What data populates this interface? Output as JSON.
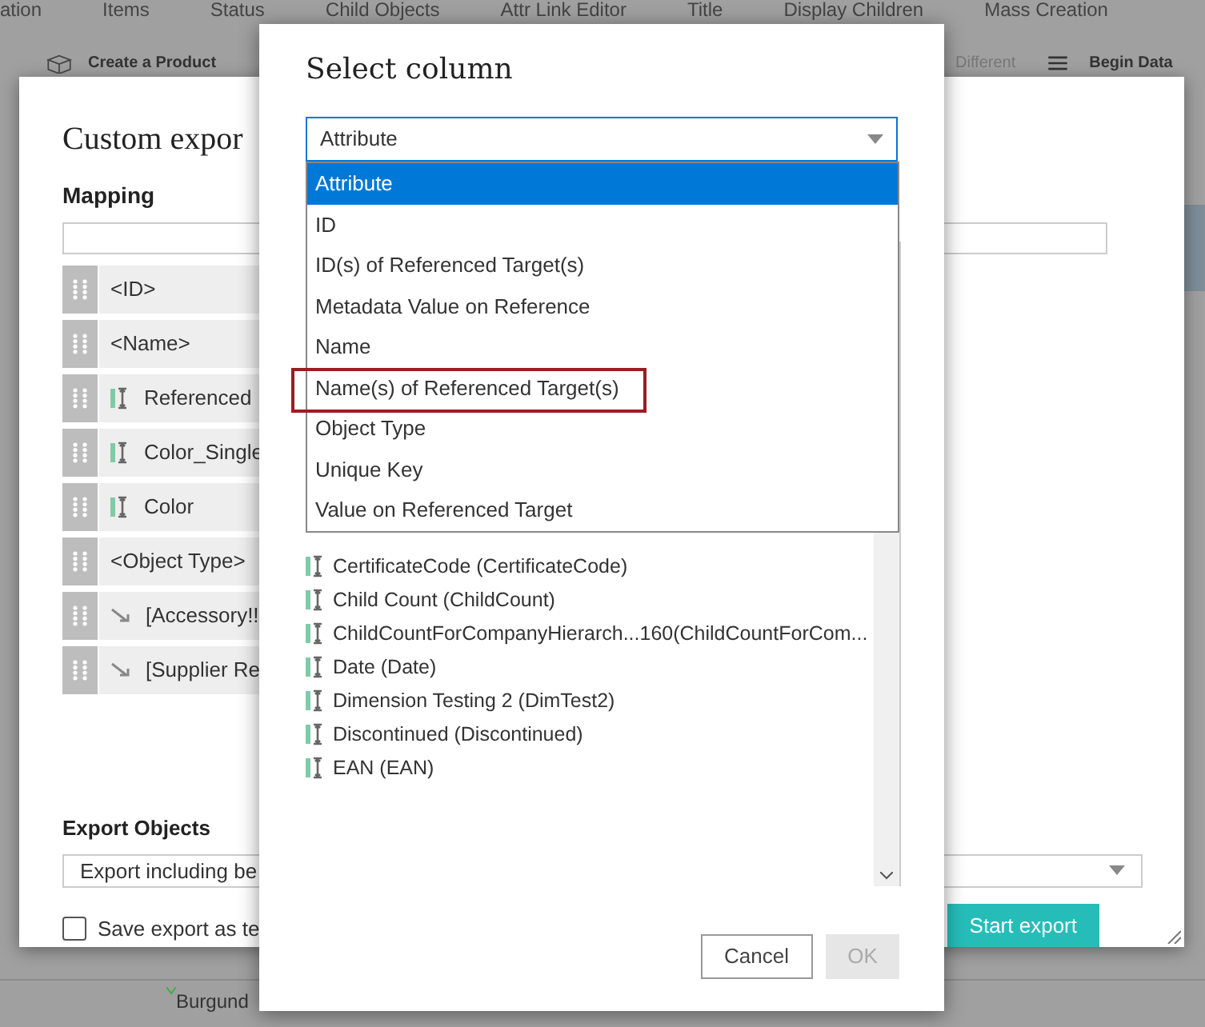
{
  "app_tabs": [
    "ation",
    "Items",
    "Status",
    "Child Objects",
    "Attr Link Editor",
    "Title",
    "Display Children",
    "Mass Creation"
  ],
  "toolbar": {
    "create": "Create a Product",
    "different": "Different",
    "begin": "Begin Data"
  },
  "table": {
    "cell": "Burgund"
  },
  "custom_export": {
    "title": "Custom expor",
    "mapping_label": "Mapping",
    "mappings": [
      {
        "kind": "plain",
        "label": "<ID>"
      },
      {
        "kind": "plain",
        "label": "<Name>"
      },
      {
        "kind": "attribute",
        "label": "Referenced"
      },
      {
        "kind": "attribute",
        "label": "Color_Single"
      },
      {
        "kind": "attribute",
        "label": "Color"
      },
      {
        "kind": "plain",
        "label": "<Object Type>"
      },
      {
        "kind": "reference",
        "label": "[Accessory!!"
      },
      {
        "kind": "reference",
        "label": "[Supplier Re"
      }
    ],
    "export_objects_label": "Export Objects",
    "export_objects_value": "Export including be",
    "save_template": {
      "label": "Save export as te",
      "checked": false
    },
    "start_button": "Start export"
  },
  "select_column": {
    "title": "Select column",
    "value": "Attribute",
    "options": [
      {
        "label": "Attribute",
        "selected": true,
        "highlighted": false
      },
      {
        "label": "ID",
        "selected": false,
        "highlighted": false
      },
      {
        "label": "ID(s) of Referenced Target(s)",
        "selected": false,
        "highlighted": false
      },
      {
        "label": "Metadata Value on Reference",
        "selected": false,
        "highlighted": false
      },
      {
        "label": "Name",
        "selected": false,
        "highlighted": false
      },
      {
        "label": "Name(s) of Referenced Target(s)",
        "selected": false,
        "highlighted": true
      },
      {
        "label": "Object Type",
        "selected": false,
        "highlighted": false
      },
      {
        "label": "Unique Key",
        "selected": false,
        "highlighted": false
      },
      {
        "label": "Value on Referenced Target",
        "selected": false,
        "highlighted": false
      }
    ],
    "attributes": [
      "CertificateCode (CertificateCode)",
      "Child Count (ChildCount)",
      "ChildCountForCompanyHierarch...160(ChildCountForCom...",
      "Date (Date)",
      "Dimension Testing 2 (DimTest2)",
      "Discontinued (Discontinued)",
      "EAN (EAN)"
    ],
    "cancel": "Cancel",
    "ok": {
      "label": "OK",
      "disabled": true
    }
  }
}
